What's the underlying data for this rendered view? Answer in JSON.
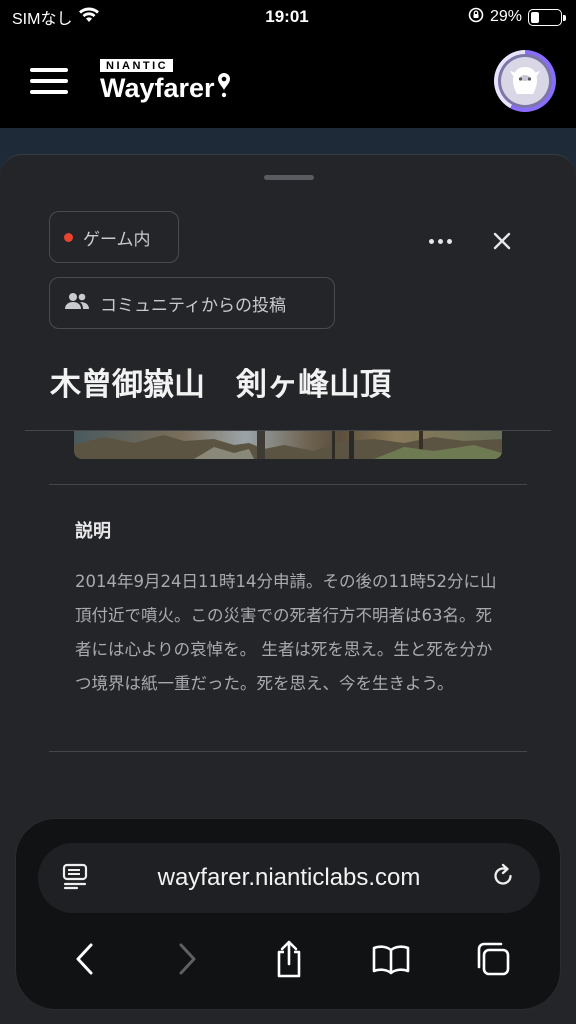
{
  "status_bar": {
    "carrier": "SIMなし",
    "time": "19:01",
    "battery": "29%",
    "battery_level": 0.29
  },
  "header": {
    "logo_top": "NIANTIC",
    "logo_word": "Wayfarer",
    "avatar_progress": 0.58
  },
  "sheet": {
    "chip_ingame": "ゲーム内",
    "chip_community": "コミュニティからの投稿",
    "title": "木曾御嶽山　剣ヶ峰山頂",
    "description_heading": "説明",
    "description_text": "2014年9月24日11時14分申請。その後の11時52分に山頂付近で噴火。この災害での死者行方不明者は63名。死者には心よりの哀悼を。 生者は死を思え。生と死を分かつ境界は紙一重だった。死を思え、今を生きよう。"
  },
  "browser": {
    "url": "wayfarer.nianticlabs.com"
  },
  "colors": {
    "accent_dot": "#e8452c",
    "avatar_ring": "#8a6cff"
  }
}
